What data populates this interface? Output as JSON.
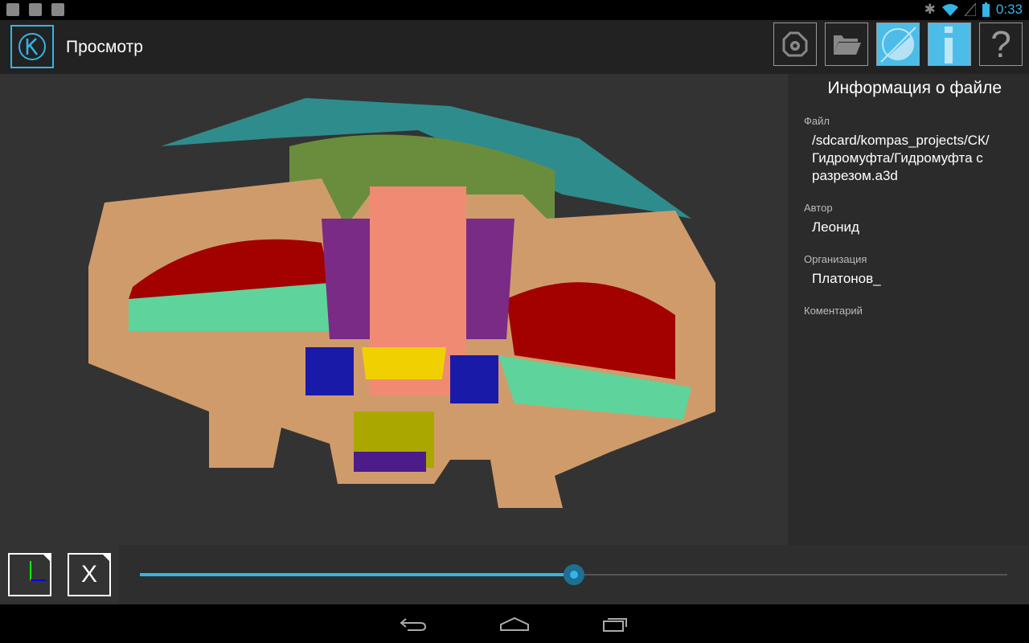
{
  "status": {
    "time": "0:33",
    "icons": [
      "broom-icon",
      "chat-icon",
      "image-icon",
      "bluetooth-icon",
      "wifi-icon",
      "signal-icon",
      "battery-icon"
    ]
  },
  "actionbar": {
    "title": "Просмотр",
    "buttons": [
      "scene-button",
      "open-folder-button",
      "section-button",
      "info-button",
      "help-button"
    ],
    "help_label": "?",
    "accent": "#33b5e5"
  },
  "info": {
    "heading": "Информация о файле",
    "fields": [
      {
        "label": "Файл",
        "value": "/sdcard/kompas_projects/СК/Гидромуфта/Гидромуфта с разрезом.a3d"
      },
      {
        "label": "Автор",
        "value": "Леонид"
      },
      {
        "label": "Организация",
        "value": "Платонов_"
      },
      {
        "label": "Коментарий",
        "value": ""
      }
    ]
  },
  "bottom": {
    "axis_label": "X",
    "slider_value": 0.5
  }
}
